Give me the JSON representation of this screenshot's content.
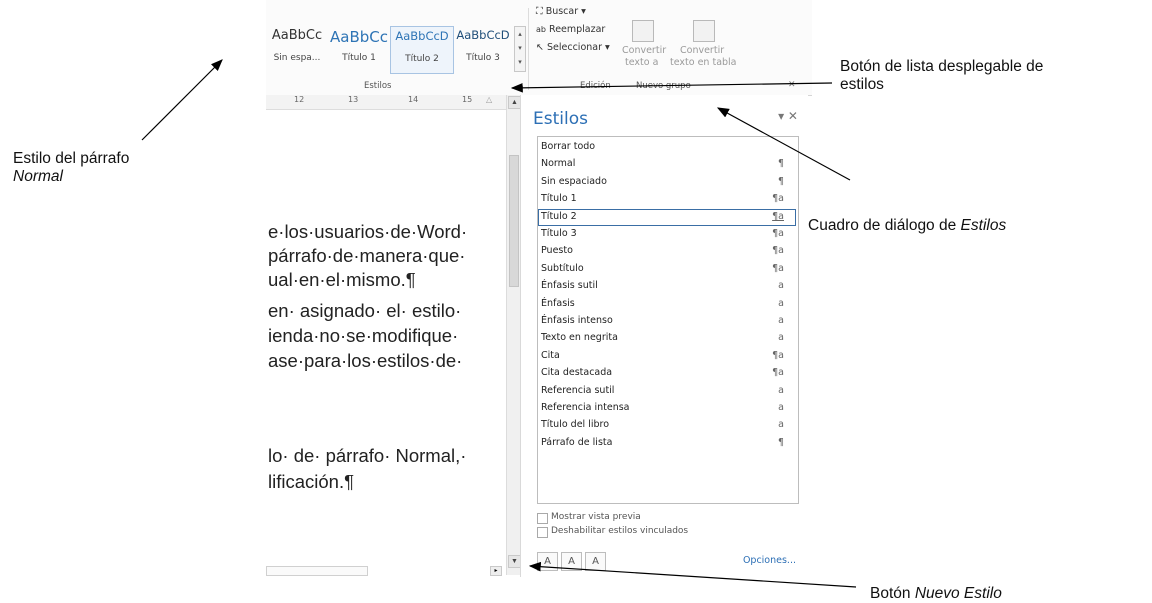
{
  "ribbon": {
    "styles": [
      {
        "sample": "AaBbCc",
        "caption": "Sin espa...",
        "color": "#333333"
      },
      {
        "sample": "AaBbCc",
        "caption": "Título 1",
        "color": "#2e74b5"
      },
      {
        "sample": "AaBbCcD",
        "caption": "Título 2",
        "color": "#2e74b5"
      },
      {
        "sample": "AaBbCcD",
        "caption": "Título 3",
        "color": "#1f4e79"
      }
    ],
    "styles_group_label": "Estilos",
    "edit": {
      "find": "Buscar",
      "replace": "Reemplazar",
      "select": "Seleccionar",
      "group_label": "Edición"
    },
    "new_group": {
      "btn1": [
        "Convertir",
        "texto a"
      ],
      "btn2": [
        "Convertir",
        "texto en tabla"
      ],
      "group_label": "Nuevo grupo"
    }
  },
  "ruler": {
    "ticks": [
      "12",
      "13",
      "14",
      "15"
    ]
  },
  "document": {
    "lines": [
      "e·los·usuarios·de·Word·",
      "párrafo·de·manera·que·",
      "ual·en·el·mismo.¶",
      "en· asignado· el· estilo·",
      "ienda·no·se·modifique·",
      "ase·para·los·estilos·de·",
      "lo· de· párrafo· Normal,·",
      "lificación.¶"
    ]
  },
  "pane": {
    "title": "Estilos",
    "controls": "▾ ✕",
    "styles": [
      {
        "name": "Borrar todo",
        "icon": ""
      },
      {
        "name": "Normal",
        "icon": "¶"
      },
      {
        "name": "Sin espaciado",
        "icon": "¶"
      },
      {
        "name": "Título 1",
        "icon": "¶a"
      },
      {
        "name": "Título 2",
        "icon": "¶a"
      },
      {
        "name": "Título 3",
        "icon": "¶a"
      },
      {
        "name": "Puesto",
        "icon": "¶a"
      },
      {
        "name": "Subtítulo",
        "icon": "¶a"
      },
      {
        "name": "Énfasis sutil",
        "icon": "a"
      },
      {
        "name": "Énfasis",
        "icon": "a"
      },
      {
        "name": "Énfasis intenso",
        "icon": "a"
      },
      {
        "name": "Texto en negrita",
        "icon": "a"
      },
      {
        "name": "Cita",
        "icon": "¶a"
      },
      {
        "name": "Cita destacada",
        "icon": "¶a"
      },
      {
        "name": "Referencia sutil",
        "icon": "a"
      },
      {
        "name": "Referencia intensa",
        "icon": "a"
      },
      {
        "name": "Título del libro",
        "icon": "a"
      },
      {
        "name": "Párrafo de lista",
        "icon": "¶"
      }
    ],
    "selected_style": "Título 2",
    "show_preview": "Mostrar vista previa",
    "disable_linked": "Deshabilitar estilos vinculados",
    "options": "Opciones..."
  },
  "annotations": {
    "paragraph_style_line1": "Estilo del párrafo",
    "paragraph_style_line2": "Normal",
    "dropdown_button_line1": "Botón de lista desplegable de",
    "dropdown_button_line2": "estilos",
    "dialog_prefix": "Cuadro de diálogo de ",
    "dialog_italic": "Estilos",
    "new_style_prefix": "Botón ",
    "new_style_italic": "Nuevo Estilo"
  }
}
